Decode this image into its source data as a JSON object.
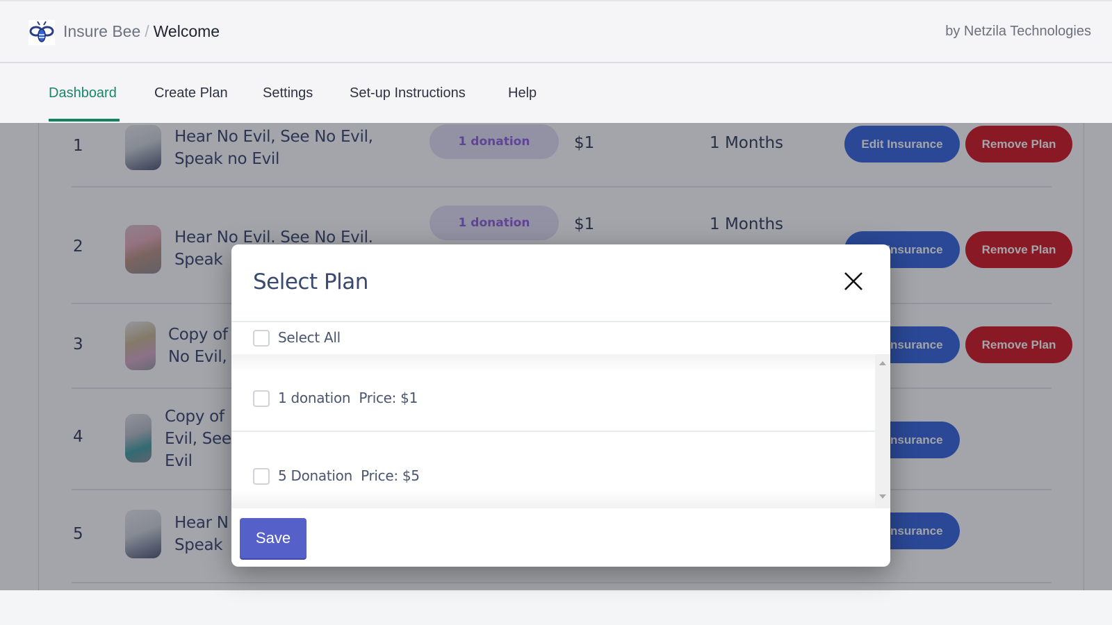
{
  "header": {
    "app_name": "Insure Bee",
    "separator": "/",
    "page": "Welcome",
    "byline": "by Netzila Technologies",
    "logo_icon": "bee-icon"
  },
  "nav": {
    "tabs": [
      {
        "label": "Dashboard",
        "active": true
      },
      {
        "label": "Create Plan",
        "active": false
      },
      {
        "label": "Settings",
        "active": false
      },
      {
        "label": "Set-up Instructions",
        "active": false
      },
      {
        "label": "Help",
        "active": false
      }
    ]
  },
  "table": {
    "rows": [
      {
        "index": "1",
        "title_line1": "Hear No Evil, See No Evil,",
        "title_line2": "Speak no Evil",
        "title_line3": "",
        "plan": "1 donation",
        "price": "$1",
        "duration": "1 Months",
        "edit_label": "Edit Insurance",
        "remove_label": "Remove Plan"
      },
      {
        "index": "2",
        "title_line1": "Hear No Evil. See No Evil.",
        "title_line2": "Speak",
        "title_line3": "",
        "plan": "1 donation",
        "price": "$1",
        "duration": "1 Months",
        "edit_label": "Edit Insurance",
        "remove_label": "Remove Plan"
      },
      {
        "index": "3",
        "title_line1": "Copy of",
        "title_line2": "No Evil,",
        "title_line3": "",
        "plan": "",
        "price": "",
        "duration": "",
        "edit_label": "Edit Insurance",
        "remove_label": "Remove Plan"
      },
      {
        "index": "4",
        "title_line1": "Copy of",
        "title_line2": "Evil, See",
        "title_line3": "Evil",
        "plan": "",
        "price": "",
        "duration": "",
        "edit_label": "Edit Insurance",
        "remove_label": ""
      },
      {
        "index": "5",
        "title_line1": "Hear N",
        "title_line2": "Speak",
        "title_line3": "",
        "plan": "",
        "price": "",
        "duration": "",
        "edit_label": "Edit Insurance",
        "remove_label": ""
      }
    ]
  },
  "modal": {
    "title": "Select Plan",
    "close_icon": "close-icon",
    "select_all_label": "Select All",
    "select_all_checked": false,
    "options": [
      {
        "name": "1 donation",
        "price_label": "Price: $1",
        "checked": false
      },
      {
        "name": "5 Donation",
        "price_label": "Price: $5",
        "checked": false
      }
    ],
    "save_label": "Save"
  },
  "colors": {
    "active_tab": "#17876a",
    "edit_button": "#2f5fdc",
    "remove_button": "#d3101a",
    "save_button": "#5561c8",
    "plan_pill_text": "#8a5ad8"
  }
}
